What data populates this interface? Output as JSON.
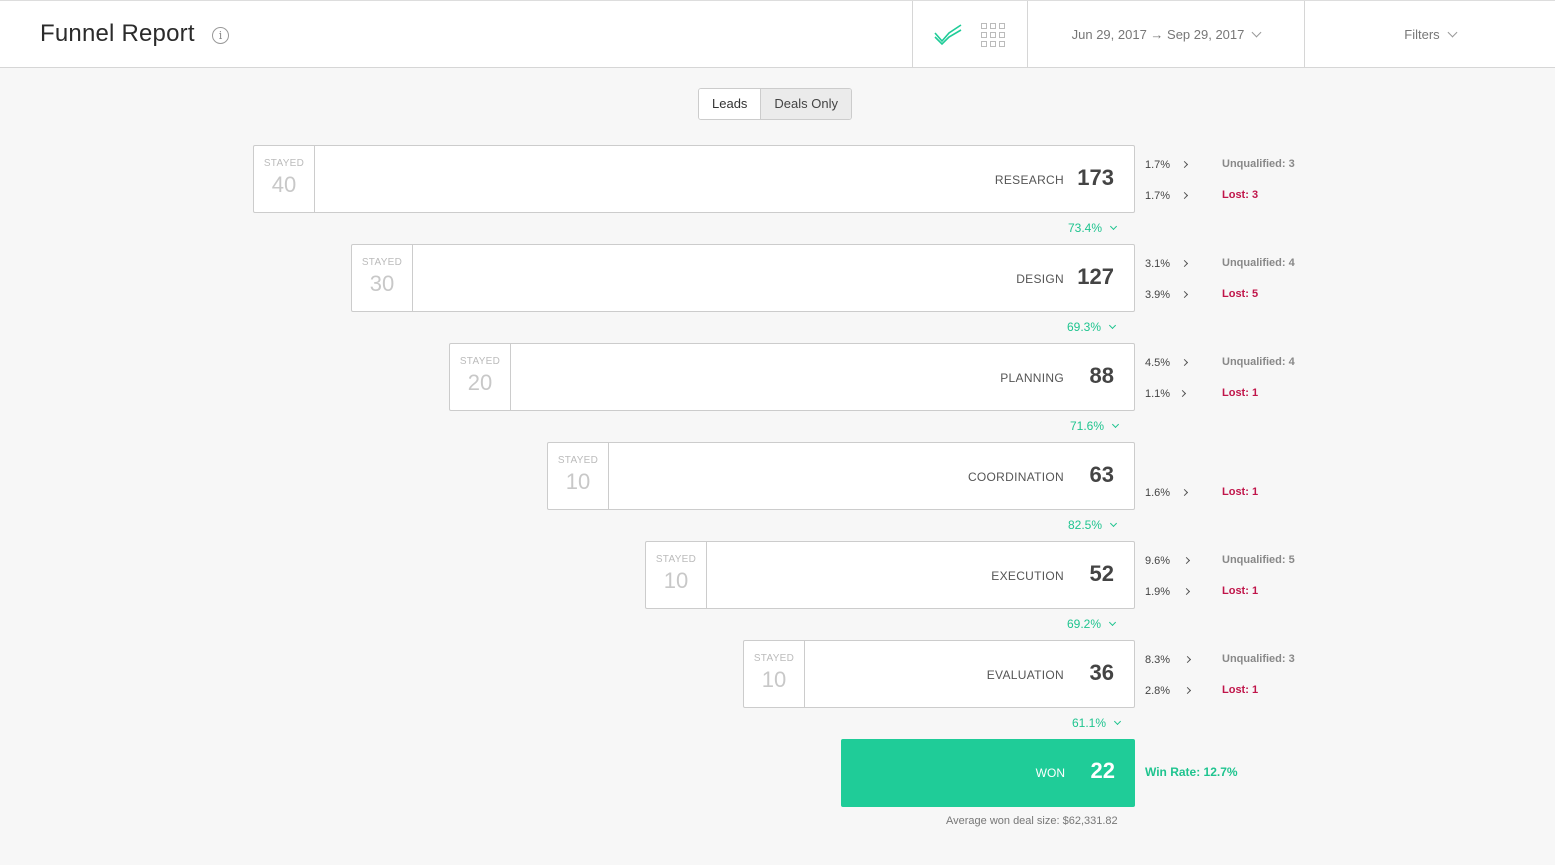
{
  "header": {
    "title": "Funnel Report",
    "info_icon": "i",
    "date_range": "Jun 29, 2017 → Sep 29, 2017",
    "filters_label": "Filters",
    "accent_color": "#1fcc98"
  },
  "toggle": {
    "leads": "Leads",
    "deals_only": "Deals Only",
    "selected": "Leads"
  },
  "stages": [
    {
      "name": "RESEARCH",
      "count": "173",
      "stayed_label": "STAYED",
      "stayed": "40",
      "conversion": "73.4%",
      "unqualified_pct": "1.7%",
      "unqualified": "Unqualified: 3",
      "lost_pct": "1.7%",
      "lost": "Lost: 3"
    },
    {
      "name": "DESIGN",
      "count": "127",
      "stayed_label": "STAYED",
      "stayed": "30",
      "conversion": "69.3%",
      "unqualified_pct": "3.1%",
      "unqualified": "Unqualified: 4",
      "lost_pct": "3.9%",
      "lost": "Lost: 5"
    },
    {
      "name": "PLANNING",
      "count": "88",
      "stayed_label": "STAYED",
      "stayed": "20",
      "conversion": "71.6%",
      "unqualified_pct": "4.5%",
      "unqualified": "Unqualified: 4",
      "lost_pct": "1.1%",
      "lost": "Lost: 1"
    },
    {
      "name": "COORDINATION",
      "count": "63",
      "stayed_label": "STAYED",
      "stayed": "10",
      "conversion": "82.5%",
      "lost_pct": "1.6%",
      "lost": "Lost: 1"
    },
    {
      "name": "EXECUTION",
      "count": "52",
      "stayed_label": "STAYED",
      "stayed": "10",
      "conversion": "69.2%",
      "unqualified_pct": "9.6%",
      "unqualified": "Unqualified: 5",
      "lost_pct": "1.9%",
      "lost": "Lost: 1"
    },
    {
      "name": "EVALUATION",
      "count": "36",
      "stayed_label": "STAYED",
      "stayed": "10",
      "conversion": "61.1%",
      "unqualified_pct": "8.3%",
      "unqualified": "Unqualified: 3",
      "lost_pct": "2.8%",
      "lost": "Lost: 1"
    }
  ],
  "won": {
    "label": "WON",
    "count": "22",
    "win_rate": "Win Rate: 12.7%",
    "avg_deal": "Average won deal size: $62,331.82"
  }
}
